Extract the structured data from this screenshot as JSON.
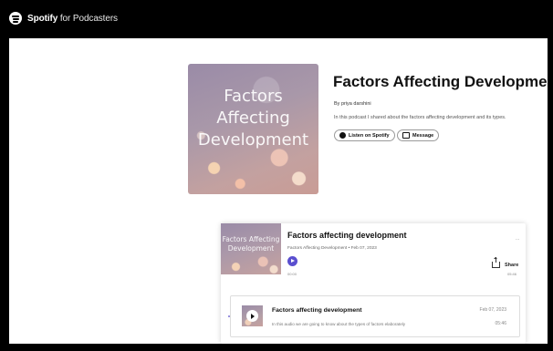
{
  "brand": {
    "name": "Spotify",
    "suffix": "for Podcasters",
    "icon": "spotify-logo-icon"
  },
  "show": {
    "cover_text": "Factors Affecting Development",
    "title": "Factors Affecting Development",
    "byline": "By priya darshini",
    "description": "In this podcast I shared about the factors affecting development and its types.",
    "listen_label": "Listen on Spotify",
    "message_label": "Message"
  },
  "episode": {
    "art_text": "Factors Affecting Development",
    "title": "Factors affecting development",
    "meta": "Factors Affecting Development • Feb 07, 2023",
    "time": "00:00",
    "more": "...",
    "share_label": "Share",
    "duration": "05:46"
  },
  "episode_list": [
    {
      "title": "Factors affecting development",
      "description": "In this audio we are going to know about the types of factors elaborately",
      "date": "Feb 07, 2023",
      "duration": "05:46"
    }
  ],
  "colors": {
    "accent": "#5a4fcf",
    "topbar": "#000000"
  }
}
